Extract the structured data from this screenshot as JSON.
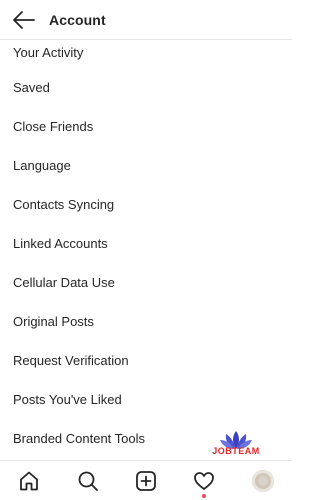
{
  "header": {
    "title": "Account"
  },
  "menu": {
    "items": [
      {
        "label": "Your Activity"
      },
      {
        "label": "Saved"
      },
      {
        "label": "Close Friends"
      },
      {
        "label": "Language"
      },
      {
        "label": "Contacts Syncing"
      },
      {
        "label": "Linked Accounts"
      },
      {
        "label": "Cellular Data Use"
      },
      {
        "label": "Original Posts"
      },
      {
        "label": "Request Verification"
      },
      {
        "label": "Posts You've Liked"
      },
      {
        "label": "Branded Content Tools"
      }
    ]
  },
  "watermark": {
    "text": "JOBTEAM"
  },
  "nav": {
    "icons": [
      "home-icon",
      "search-icon",
      "add-post-icon",
      "heart-icon",
      "avatar"
    ]
  },
  "colors": {
    "text": "#262626",
    "divider": "#e6e6e6",
    "notification": "#ed4956",
    "watermark_blue": "#3b3fbf",
    "watermark_red": "#e3272b"
  }
}
